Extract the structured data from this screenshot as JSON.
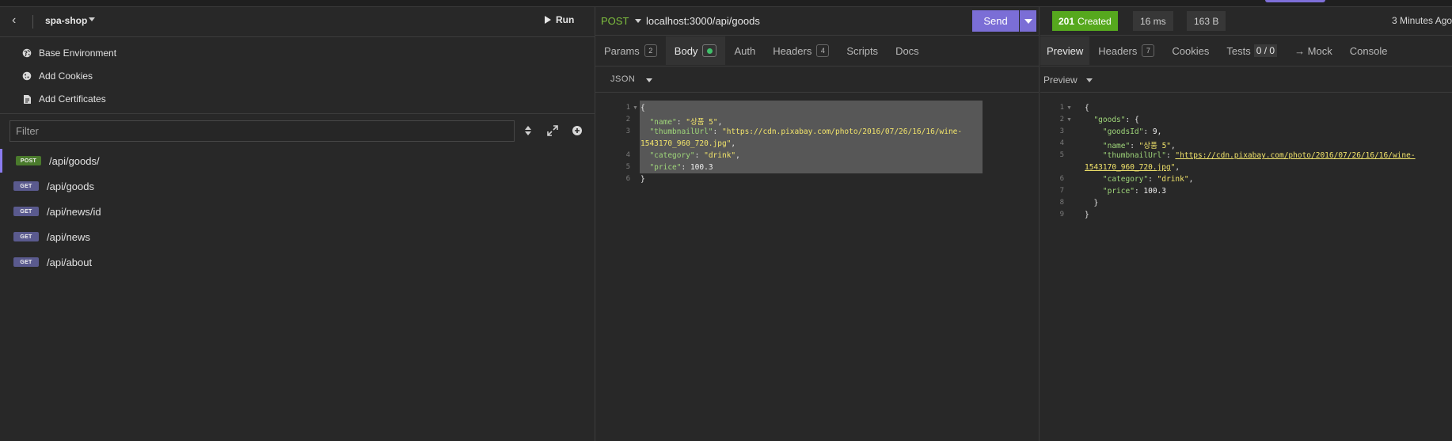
{
  "sidebar": {
    "workspace_name": "spa-shop",
    "run_label": "Run",
    "env_items": [
      {
        "label": "Base Environment",
        "icon": "globe-icon"
      },
      {
        "label": "Add Cookies",
        "icon": "cookie-icon"
      },
      {
        "label": "Add Certificates",
        "icon": "certificate-icon"
      }
    ],
    "filter_placeholder": "Filter",
    "requests": [
      {
        "method": "POST",
        "path": "/api/goods/",
        "active": true
      },
      {
        "method": "GET",
        "path": "/api/goods",
        "active": false
      },
      {
        "method": "GET",
        "path": "/api/news/id",
        "active": false
      },
      {
        "method": "GET",
        "path": "/api/news",
        "active": false
      },
      {
        "method": "GET",
        "path": "/api/about",
        "active": false
      }
    ]
  },
  "request": {
    "method": "POST",
    "url": "localhost:3000/api/goods",
    "send_label": "Send",
    "tabs": [
      {
        "label": "Params",
        "count": "2"
      },
      {
        "label": "Body",
        "count": ""
      },
      {
        "label": "Auth",
        "count": ""
      },
      {
        "label": "Headers",
        "count": "4"
      },
      {
        "label": "Scripts",
        "count": ""
      },
      {
        "label": "Docs",
        "count": ""
      }
    ],
    "body_type": "JSON",
    "body_lines": [
      "1",
      "2",
      "3",
      "4",
      "5",
      "6"
    ],
    "body": {
      "name_key": "\"name\"",
      "name_val": "\"상품 5\"",
      "thumb_key": "\"thumbnailUrl\"",
      "thumb_val_a": "\"https://cdn.pixabay.com/photo/2016/07/26/16/16/wine-",
      "thumb_val_b": "1543170_960_720.jpg\"",
      "category_key": "\"category\"",
      "category_val": "\"drink\"",
      "price_key": "\"price\"",
      "price_val": "100.3"
    }
  },
  "response": {
    "status_code": "201",
    "status_text": "Created",
    "time": "16 ms",
    "size": "163 B",
    "ago": "3 Minutes Ago",
    "tabs": [
      {
        "label": "Preview",
        "count": ""
      },
      {
        "label": "Headers",
        "count": "7"
      },
      {
        "label": "Cookies",
        "count": ""
      },
      {
        "label": "Tests",
        "count": "0 / 0"
      },
      {
        "label": "→ Mock",
        "count": ""
      },
      {
        "label": "Console",
        "count": ""
      }
    ],
    "preview_label": "Preview",
    "lines": [
      "1",
      "2",
      "3",
      "4",
      "5",
      "",
      "6",
      "7",
      "8",
      "9"
    ],
    "body": {
      "goods_key": "\"goods\"",
      "goodsId_key": "\"goodsId\"",
      "goodsId_val": "9",
      "name_key": "\"name\"",
      "name_val": "\"상품 5\"",
      "thumb_key": "\"thumbnailUrl\"",
      "thumb_val_a": "\"https://cdn.pixabay.com/photo/2016/07/26/16/16/wine-",
      "thumb_val_b": "1543170_960_720.jpg",
      "category_key": "\"category\"",
      "category_val": "\"drink\"",
      "price_key": "\"price\"",
      "price_val": "100.3"
    }
  },
  "colors": {
    "accent": "#7b6ed6",
    "status_ok": "#56a81e",
    "json_key": "#9fd67a",
    "json_string": "#f2e46b"
  }
}
